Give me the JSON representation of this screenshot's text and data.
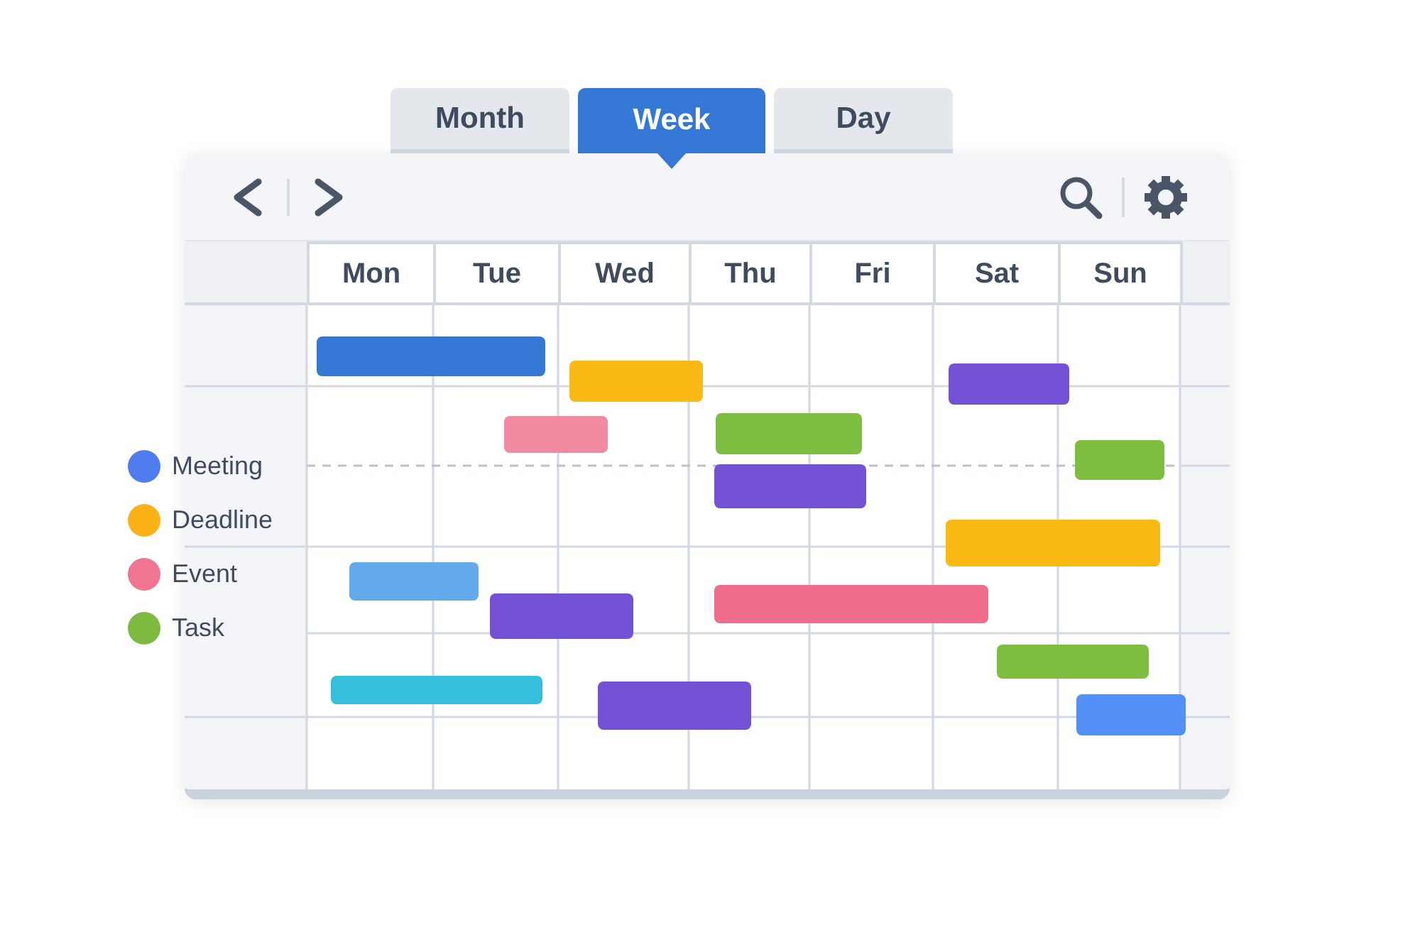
{
  "tabs": [
    {
      "label": "Month",
      "selected": false
    },
    {
      "label": "Week",
      "selected": true
    },
    {
      "label": "Day",
      "selected": false
    }
  ],
  "days": [
    "Mon",
    "Tue",
    "Wed",
    "Thu",
    "Fri",
    "Sat",
    "Sun"
  ],
  "legend": [
    {
      "label": "Meeting",
      "color": "#4f7df0"
    },
    {
      "label": "Deadline",
      "color": "#fbb216"
    },
    {
      "label": "Event",
      "color": "#f07590"
    },
    {
      "label": "Task",
      "color": "#7cbb3f"
    }
  ],
  "events": [
    {
      "color": "#3577d4"
    },
    {
      "color": "#fbb914"
    },
    {
      "color": "#7450d4"
    },
    {
      "color": "#f08aa0"
    },
    {
      "color": "#7dbd3f"
    },
    {
      "color": "#7dbd3f"
    },
    {
      "color": "#7450d4"
    },
    {
      "color": "#fbb914"
    },
    {
      "color": "#63aaed"
    },
    {
      "color": "#7450d4"
    },
    {
      "color": "#f06c8c"
    },
    {
      "color": "#7dbd3f"
    },
    {
      "color": "#35bfdc"
    },
    {
      "color": "#7450d4"
    },
    {
      "color": "#5290f5"
    }
  ]
}
